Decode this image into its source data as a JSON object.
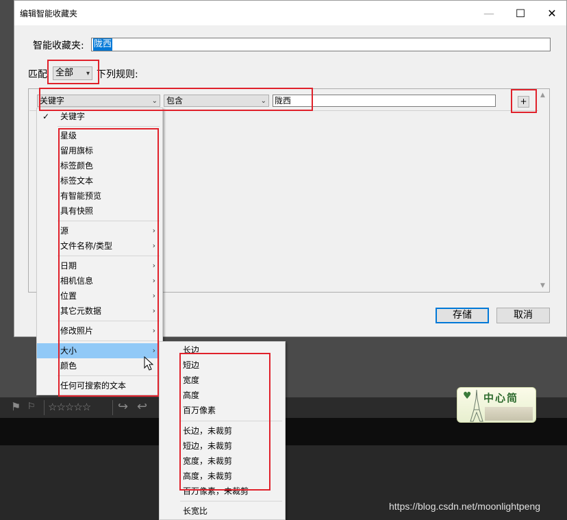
{
  "dialog": {
    "title": "编辑智能收藏夹",
    "name_label": "智能收藏夹:",
    "name_value": "陇西",
    "match_prefix": "匹配",
    "match_value": "全部",
    "match_suffix": "下列规则:",
    "rule": {
      "field": "关键字",
      "operator": "包含",
      "value": "陇西",
      "add_label": "+"
    },
    "save_label": "存储",
    "cancel_label": "取消"
  },
  "window_controls": {
    "minimize": "—",
    "maximize": "☐",
    "close": "✕"
  },
  "field_menu": {
    "checked_item": "关键字",
    "group1": [
      "星级",
      "留用旗标",
      "标签颜色",
      "标签文本",
      "有智能预览",
      "具有快照"
    ],
    "group2": [
      "源",
      "文件名称/类型"
    ],
    "group3": [
      "日期",
      "相机信息",
      "位置",
      "其它元数据"
    ],
    "group4": [
      "修改照片"
    ],
    "group5": [
      "大小",
      "颜色"
    ],
    "group6": [
      "任何可搜索的文本"
    ],
    "submenu_arrow": "›"
  },
  "size_submenu": {
    "group1": [
      "长边",
      "短边",
      "宽度",
      "高度",
      "百万像素"
    ],
    "group2": [
      "长边，未裁剪",
      "短边，未裁剪",
      "宽度，未裁剪",
      "高度，未裁剪",
      "百万像素，未裁剪"
    ],
    "group3": [
      "长宽比"
    ]
  },
  "background_toolbar": {
    "stars": "☆☆☆☆☆"
  },
  "watermark": {
    "logo_text": "中心简",
    "url": "https://blog.csdn.net/moonlightpeng"
  },
  "colors": {
    "accent": "#0078d7",
    "highlight": "#91c9f7",
    "annotation": "#e0202a"
  }
}
